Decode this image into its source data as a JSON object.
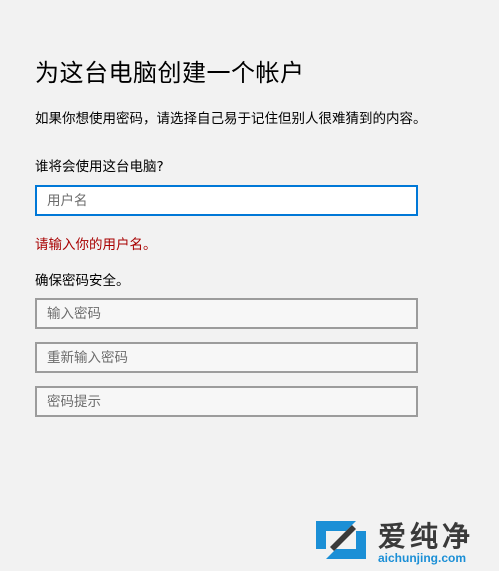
{
  "page": {
    "title": "为这台电脑创建一个帐户",
    "subtitle": "如果你想使用密码，请选择自己易于记住但别人很难猜到的内容。",
    "who_label": "谁将会使用这台电脑?",
    "username_placeholder": "用户名",
    "username_value": "",
    "error_text": "请输入你的用户名。",
    "secure_label": "确保密码安全。",
    "password_placeholder": "输入密码",
    "reenter_placeholder": "重新输入密码",
    "hint_placeholder": "密码提示"
  },
  "watermark": {
    "brand_text": "爱纯净",
    "url": "aichunjing.com"
  },
  "colors": {
    "background": "#f2f2f2",
    "focus_border": "#0078d7",
    "error": "#a80000",
    "watermark_url": "#1b8fd6"
  }
}
